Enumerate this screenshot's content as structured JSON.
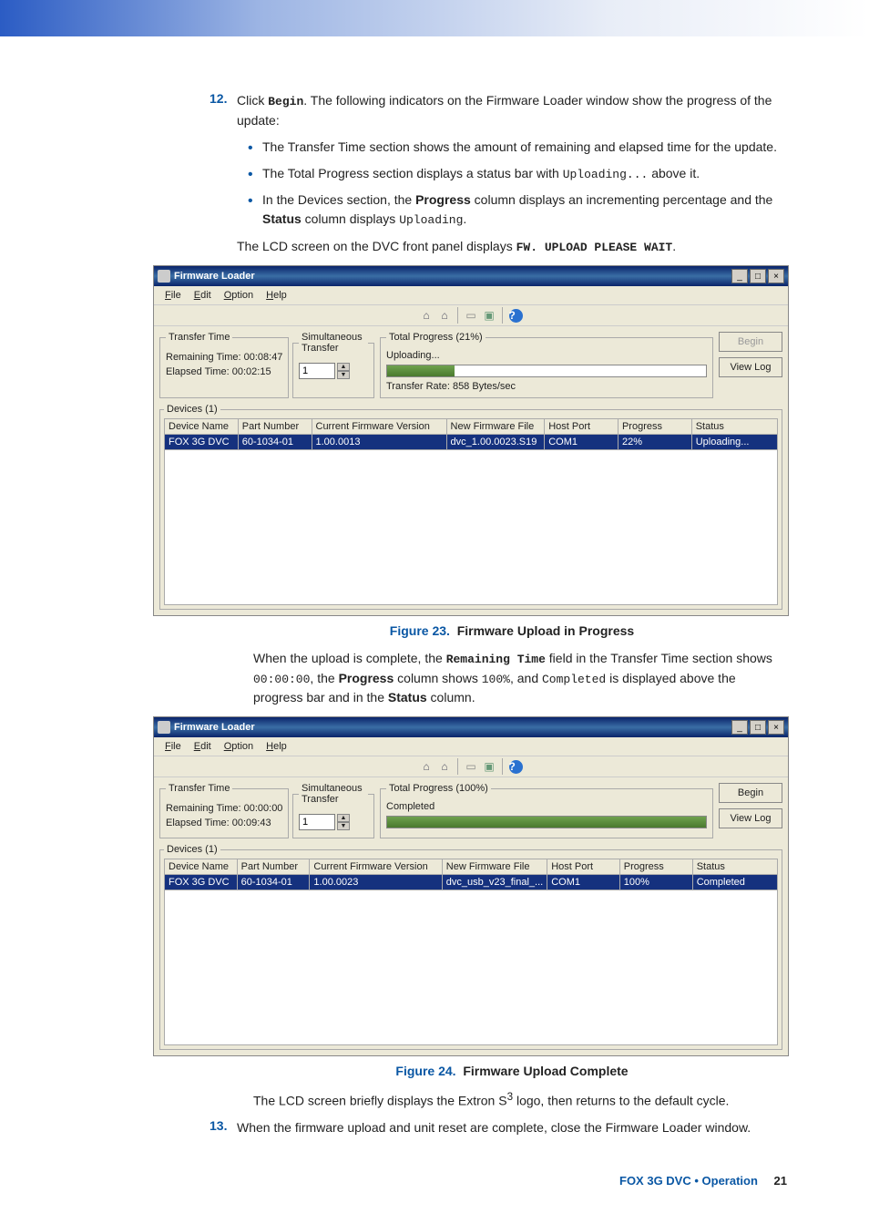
{
  "step12": {
    "num": "12.",
    "intro_pre": "Click ",
    "begin": "Begin",
    "intro_post": ". The following indicators on the Firmware Loader window show the progress of the update:",
    "bullet1": "The Transfer Time section shows the amount of remaining and elapsed time for the update.",
    "bullet2_pre": "The Total Progress section displays a status bar with ",
    "bullet2_code": "Uploading...",
    "bullet2_post": " above it.",
    "bullet3_pre": "In the Devices section, the ",
    "bullet3_b1": "Progress",
    "bullet3_mid": " column displays an incrementing percentage and the ",
    "bullet3_b2": "Status",
    "bullet3_mid2": " column displays ",
    "bullet3_code": "Uploading",
    "bullet3_post": ".",
    "lcd_pre": "The LCD screen on the DVC front panel displays ",
    "lcd_code": "FW. UPLOAD PLEASE WAIT",
    "lcd_post": "."
  },
  "fig23": {
    "label": "Figure 23.",
    "title": "Firmware Upload in Progress"
  },
  "mid_para": {
    "pre": "When the upload is complete, the ",
    "b1": "Remaining Time",
    "mid1": " field in the Transfer Time section shows ",
    "c1": "00:00:00",
    "mid2": ", the ",
    "b2": "Progress",
    "mid3": " column shows ",
    "c2": "100%",
    "mid4": ", and ",
    "c3": "Completed",
    "mid5": " is displayed above the progress bar and in the ",
    "b3": "Status",
    "post": " column."
  },
  "fig24": {
    "label": "Figure 24.",
    "title": "Firmware Upload Complete"
  },
  "s3_para_pre": "The LCD screen briefly displays the Extron S",
  "s3_sup": "3",
  "s3_para_post": " logo, then returns to the default cycle.",
  "step13": {
    "num": "13.",
    "text": "When the firmware upload and unit reset are complete, close the Firmware Loader window."
  },
  "shot_common": {
    "title": "Firmware Loader",
    "menu": {
      "file": "File",
      "edit": "Edit",
      "option": "Option",
      "help": "Help"
    },
    "buttons": {
      "begin": "Begin",
      "viewlog": "View Log"
    },
    "labels": {
      "transfer_time": "Transfer Time",
      "remaining": "Remaining Time:",
      "elapsed": "Elapsed Time:",
      "sim": "Simultaneous Transfer",
      "sim_value": "1",
      "devices": "Devices (1)"
    },
    "cols": {
      "devname": "Device Name",
      "partnum": "Part Number",
      "curfw": "Current Firmware Version",
      "newfw": "New Firmware File",
      "host": "Host Port",
      "prog": "Progress",
      "status": "Status"
    }
  },
  "shot1": {
    "remaining": "00:08:47",
    "elapsed": "00:02:15",
    "progress_legend": "Total Progress (21%)",
    "progress_status": "Uploading...",
    "progress_pct": 21,
    "rate": "Transfer Rate: 858 Bytes/sec",
    "begin_disabled": true,
    "row": {
      "devname": "FOX 3G DVC",
      "partnum": "60-1034-01",
      "curfw": "1.00.0013",
      "newfw": "dvc_1.00.0023.S19",
      "host": "COM1",
      "prog": "22%",
      "status": "Uploading..."
    }
  },
  "shot2": {
    "remaining": "00:00:00",
    "elapsed": "00:09:43",
    "progress_legend": "Total Progress (100%)",
    "progress_status": "Completed",
    "progress_pct": 100,
    "rate": "",
    "begin_disabled": false,
    "row": {
      "devname": "FOX 3G DVC",
      "partnum": "60-1034-01",
      "curfw": "1.00.0023",
      "newfw": "dvc_usb_v23_final_...",
      "host": "COM1",
      "prog": "100%",
      "status": "Completed"
    }
  },
  "footer": {
    "product": "FOX 3G DVC • Operation",
    "page": "21"
  }
}
